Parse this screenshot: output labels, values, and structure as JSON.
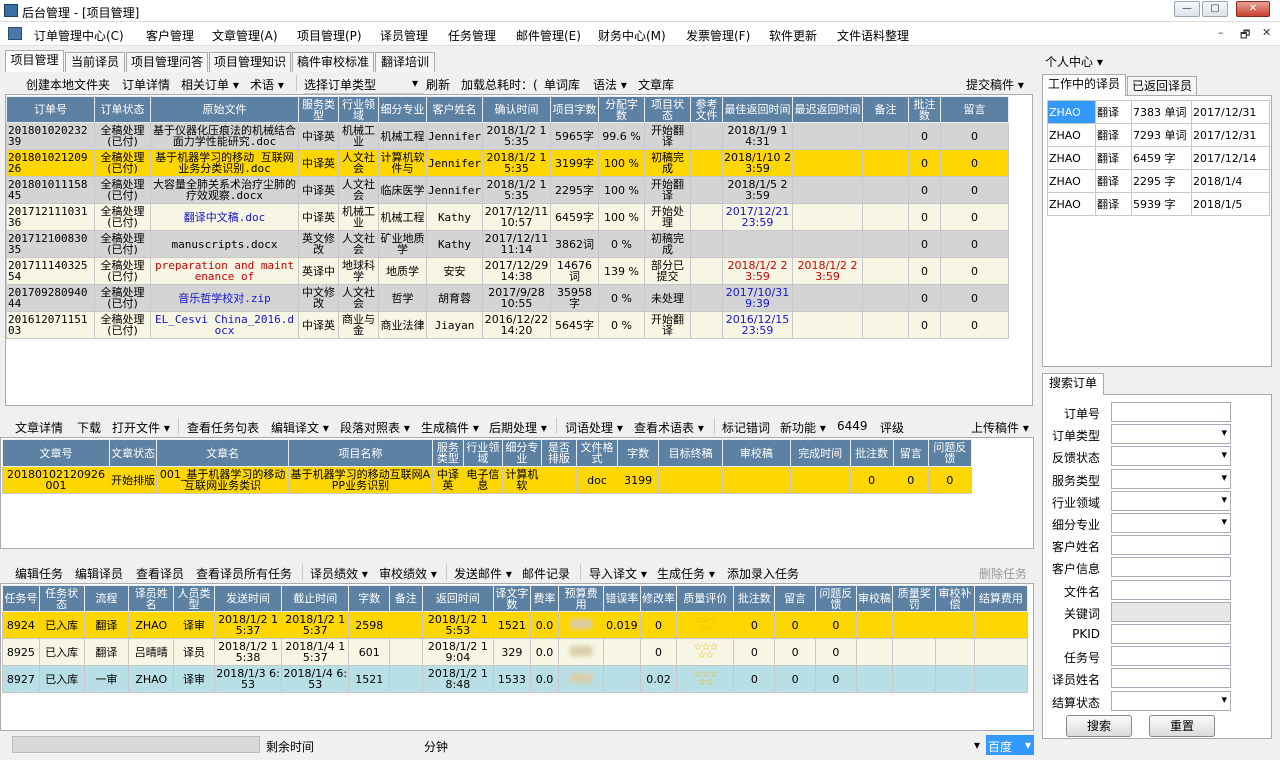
{
  "window": {
    "title": "后台管理 - [项目管理]",
    "min": "—",
    "max": "▢",
    "close": "✕"
  },
  "menu": [
    "订单管理中心(C)",
    "客户管理",
    "文章管理(A)",
    "项目管理(P)",
    "译员管理",
    "任务管理",
    "邮件管理(E)",
    "财务中心(M)",
    "发票管理(F)",
    "软件更新",
    "文件语料整理"
  ],
  "mdi_controls": [
    "–",
    "🗗",
    "✕"
  ],
  "tabs": [
    "项目管理",
    "当前译员",
    "项目管理问答",
    "项目管理知识",
    "稿件审校标准",
    "翻译培训"
  ],
  "toolbar1": {
    "create_folder": "创建本地文件夹",
    "order_detail": "订单详情",
    "related_order": "相关订单 ▾",
    "term": "术语 ▾",
    "order_type": "选择订单类型",
    "refresh": "刷新",
    "load_time": "加载总耗时：(",
    "word_lib": "单词库",
    "grammar": "语法 ▾",
    "article_lib": "文章库",
    "submit": "提交稿件 ▾"
  },
  "orders": {
    "headers": [
      "订单号",
      "订单状态",
      "原始文件",
      "服务类型",
      "行业领域",
      "细分专业",
      "客户姓名",
      "确认时间",
      "项目字数",
      "分配字数",
      "项目状态",
      "参考文件",
      "最佳返回时间",
      "最迟返回时间",
      "备注",
      "批注数",
      "留言"
    ],
    "rows": [
      {
        "id": "20180102023239",
        "status": "全稿处理(已付)",
        "file": "基于仪器化压痕法的机械结合面力学性能研究.doc",
        "service": "中译英",
        "field": "机械工业",
        "major": "机械工程",
        "client": "Jennifer",
        "confirm": "2018/1/2 15:35",
        "words": "5965字",
        "alloc": "99.6 %",
        "pstate": "开始翻译",
        "ref": "",
        "best": "2018/1/9 14:31",
        "latest": "",
        "note": "",
        "ann": "0",
        "msg": "0",
        "style": "gray",
        "filecls": "",
        "bestcls": ""
      },
      {
        "id": "20180102120926",
        "status": "全稿处理(已付)",
        "file": "基于机器学习的移动 互联网业务分类识别.doc",
        "service": "中译英",
        "field": "人文社会",
        "major": "计算机软件与",
        "client": "Jennifer",
        "confirm": "2018/1/2 15:35",
        "words": "3199字",
        "alloc": "100 %",
        "pstate": "初稿完成",
        "ref": "",
        "best": "2018/1/10 23:59",
        "latest": "",
        "note": "",
        "ann": "0",
        "msg": "0",
        "style": "yellow",
        "filecls": "",
        "bestcls": ""
      },
      {
        "id": "20180101115845",
        "status": "全稿处理(已付)",
        "file": "大容量全肺关系术治疗尘肺的疗效观察.docx",
        "service": "中译英",
        "field": "人文社会",
        "major": "临床医学",
        "client": "Jennifer",
        "confirm": "2018/1/2 15:35",
        "words": "2295字",
        "alloc": "100 %",
        "pstate": "开始翻译",
        "ref": "",
        "best": "2018/1/5 23:59",
        "latest": "",
        "note": "",
        "ann": "0",
        "msg": "0",
        "style": "gray",
        "filecls": "",
        "bestcls": ""
      },
      {
        "id": "20171211103136",
        "status": "全稿处理(已付)",
        "file": "翻译中文稿.doc",
        "service": "中译英",
        "field": "机械工业",
        "major": "机械工程",
        "client": "Kathy",
        "confirm": "2017/12/11 10:57",
        "words": "6459字",
        "alloc": "100 %",
        "pstate": "开始处理",
        "ref": "",
        "best": "2017/12/21 23:59",
        "latest": "",
        "note": "",
        "ann": "0",
        "msg": "0",
        "style": "cream",
        "filecls": "blue",
        "bestcls": "blue"
      },
      {
        "id": "20171210083035",
        "status": "全稿处理(已付)",
        "file": "manuscripts.docx",
        "service": "英文修改",
        "field": "人文社会",
        "major": "矿业地质学",
        "client": "Kathy",
        "confirm": "2017/12/11 11:14",
        "words": "3862词",
        "alloc": "0 %",
        "pstate": "初稿完成",
        "ref": "",
        "best": "",
        "latest": "",
        "note": "",
        "ann": "0",
        "msg": "0",
        "style": "gray",
        "filecls": "",
        "bestcls": ""
      },
      {
        "id": "20171114032554",
        "status": "全稿处理(已付)",
        "file": "preparation and maintenance of",
        "service": "英译中",
        "field": "地球科学",
        "major": "地质学",
        "client": "安安",
        "confirm": "2017/12/29 14:38",
        "words": "14676词",
        "alloc": "139 %",
        "pstate": "部分已提交",
        "ref": "",
        "best": "2018/1/2 23:59",
        "latest": "2018/1/2 23:59",
        "note": "",
        "ann": "0",
        "msg": "0",
        "style": "cream",
        "filecls": "red",
        "bestcls": "red"
      },
      {
        "id": "20170928094044",
        "status": "全稿处理(已付)",
        "file": "音乐哲学校对.zip",
        "service": "中文修改",
        "field": "人文社会",
        "major": "哲学",
        "client": "胡育蓉",
        "confirm": "2017/9/28 10:55",
        "words": "35958字",
        "alloc": "0 %",
        "pstate": "未处理",
        "ref": "",
        "best": "2017/10/31 9:39",
        "latest": "",
        "note": "",
        "ann": "0",
        "msg": "0",
        "style": "gray",
        "filecls": "blue",
        "bestcls": "blue"
      },
      {
        "id": "20161207115103",
        "status": "全稿处理(已付)",
        "file": "EL_Cesvi China_2016.docx",
        "service": "中译英",
        "field": "商业与金",
        "major": "商业法律",
        "client": "Jiayan",
        "confirm": "2016/12/22 14:20",
        "words": "5645字",
        "alloc": "0 %",
        "pstate": "开始翻译",
        "ref": "",
        "best": "2016/12/15 23:59",
        "latest": "",
        "note": "",
        "ann": "0",
        "msg": "0",
        "style": "cream",
        "filecls": "blue",
        "bestcls": "blue"
      }
    ]
  },
  "toolbar2": {
    "article_detail": "文章详情",
    "download": "下载",
    "open_file": "打开文件 ▾",
    "view_sentences": "查看任务句表",
    "edit_translation": "编辑译文 ▾",
    "paragraph_table": "段落对照表 ▾",
    "generate": "生成稿件 ▾",
    "post_process": "后期处理 ▾",
    "word_process": "词语处理 ▾",
    "view_terms": "查看术语表 ▾",
    "mark_errors": "标记错词",
    "new_feature": "新功能 ▾",
    "count": "6449",
    "evaluate": "评级",
    "upload": "上传稿件 ▾"
  },
  "articles": {
    "headers": [
      "文章号",
      "文章状态",
      "文章名",
      "项目名称",
      "服务类型",
      "行业领域",
      "细分专业",
      "是否排版",
      "文件格式",
      "字数",
      "目标终稿",
      "审校稿",
      "完成时间",
      "批注数",
      "留言",
      "问题反馈"
    ],
    "rows": [
      {
        "id": "20180102120926001",
        "status": "开始排版",
        "name": "001_基于机器学习的移动 互联网业务类识",
        "project": "基于机器学习的移动互联网APP业务识别",
        "service": "中译英",
        "field": "电子信息",
        "major": "计算机软",
        "layout": "",
        "format": "doc",
        "words": "3199",
        "target": "",
        "review": "",
        "done": "",
        "ann": "0",
        "msg": "0",
        "fb": "0"
      }
    ]
  },
  "toolbar3": {
    "edit_task": "编辑任务",
    "edit_translator": "编辑译员",
    "view_translator": "查看译员",
    "view_all_tasks": "查看译员所有任务",
    "translator_perf": "译员绩效 ▾",
    "review_perf": "审校绩效 ▾",
    "send_mail": "发送邮件 ▾",
    "mail_log": "邮件记录",
    "import": "导入译文 ▾",
    "gen_task": "生成任务 ▾",
    "add_task": "添加录入任务",
    "delete_task": "删除任务"
  },
  "tasks": {
    "headers": [
      "任务号",
      "任务状态",
      "流程",
      "译员姓名",
      "人员类型",
      "发送时间",
      "截止时间",
      "字数",
      "备注",
      "返回时间",
      "译文字数",
      "费率",
      "预算费用",
      "错误率",
      "修改率",
      "质量评价",
      "批注数",
      "留言",
      "问题反馈",
      "审校稿",
      "质量奖罚",
      "审校补偿",
      "结算费用"
    ],
    "rows": [
      {
        "id": "8924",
        "status": "已入库",
        "flow": "翻译",
        "name": "ZHAO",
        "type": "译审",
        "sent": "2018/1/2 15:37",
        "due": "2018/1/2 15:37",
        "words": "2598",
        "note": "",
        "ret": "2018/1/2 15:53",
        "twords": "1521",
        "rate": "0.0",
        "err": "0.019",
        "mod": "0",
        "ann": "0",
        "msg": "0",
        "fb": "0",
        "style": "yellow"
      },
      {
        "id": "8925",
        "status": "已入库",
        "flow": "翻译",
        "name": "吕晴晴",
        "type": "译员",
        "sent": "2018/1/2 15:38",
        "due": "2018/1/4 15:37",
        "words": "601",
        "note": "",
        "ret": "2018/1/2 19:04",
        "twords": "329",
        "rate": "0.0",
        "err": "",
        "mod": "0",
        "ann": "0",
        "msg": "0",
        "fb": "0",
        "style": "cream"
      },
      {
        "id": "8927",
        "status": "已入库",
        "flow": "一审",
        "name": "ZHAO",
        "type": "译审",
        "sent": "2018/1/3 6:53",
        "due": "2018/1/4 6:53",
        "words": "1521",
        "note": "",
        "ret": "2018/1/2 18:48",
        "twords": "1533",
        "rate": "0.0",
        "err": "",
        "mod": "0.02",
        "ann": "0",
        "msg": "0",
        "fb": "0",
        "style": "cyan"
      }
    ]
  },
  "statusbar": {
    "remaining": "剩余时间",
    "minutes": "分钟",
    "engine": "百度"
  },
  "right": {
    "personal": "个人中心 ▾",
    "tabs": [
      "工作中的译员",
      "已返回译员"
    ],
    "translators": [
      {
        "name": "ZHAO",
        "task": "翻译",
        "count": "7383 单词",
        "date": "2017/12/31"
      },
      {
        "name": "ZHAO",
        "task": "翻译",
        "count": "7293 单词",
        "date": "2017/12/31"
      },
      {
        "name": "ZHAO",
        "task": "翻译",
        "count": "6459 字",
        "date": "2017/12/14"
      },
      {
        "name": "ZHAO",
        "task": "翻译",
        "count": "2295 字",
        "date": "2018/1/4"
      },
      {
        "name": "ZHAO",
        "task": "翻译",
        "count": "5939 字",
        "date": "2018/1/5"
      }
    ],
    "search_tab": "搜索订单",
    "fields": [
      {
        "label": "订单号",
        "dd": false
      },
      {
        "label": "订单类型",
        "dd": true
      },
      {
        "label": "反馈状态",
        "dd": true
      },
      {
        "label": "服务类型",
        "dd": true
      },
      {
        "label": "行业领域",
        "dd": true
      },
      {
        "label": "细分专业",
        "dd": true
      },
      {
        "label": "客户姓名",
        "dd": false
      },
      {
        "label": "客户信息",
        "dd": false
      },
      {
        "label": "文件名",
        "dd": false
      },
      {
        "label": "关键词",
        "dd": false,
        "disabled": true
      },
      {
        "label": "PKID",
        "dd": false
      },
      {
        "label": "任务号",
        "dd": false
      },
      {
        "label": "译员姓名",
        "dd": false
      },
      {
        "label": "结算状态",
        "dd": true
      }
    ],
    "search": "搜索",
    "reset": "重置"
  }
}
